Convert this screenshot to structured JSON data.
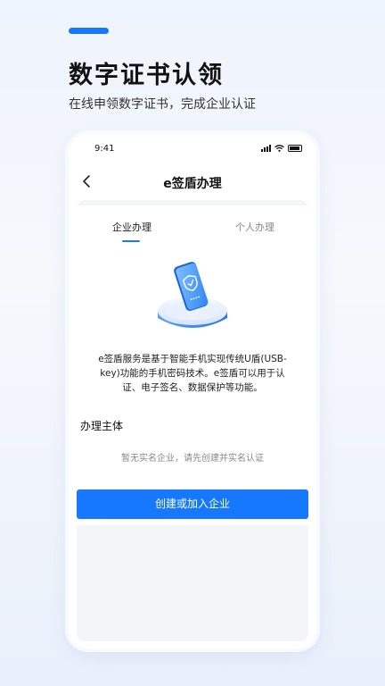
{
  "hero": {
    "title": "数字证书认领",
    "subtitle": "在线申领数字证书，完成企业认证"
  },
  "status_bar": {
    "time": "9:41"
  },
  "nav": {
    "title": "e签盾办理"
  },
  "tabs": [
    {
      "label": "企业办理",
      "active": true
    },
    {
      "label": "个人办理",
      "active": false
    }
  ],
  "description": "e签盾服务是基于智能手机实现传统U盾(USB-key)功能的手机密码技术。e签盾可以用于认证、电子签名、数据保护等功能。",
  "section": {
    "title": "办理主体",
    "empty_hint": "暂无实名企业，请先创建并实名认证"
  },
  "primary_button": {
    "label": "创建或加入企业"
  },
  "colors": {
    "accent": "#1677ff"
  }
}
